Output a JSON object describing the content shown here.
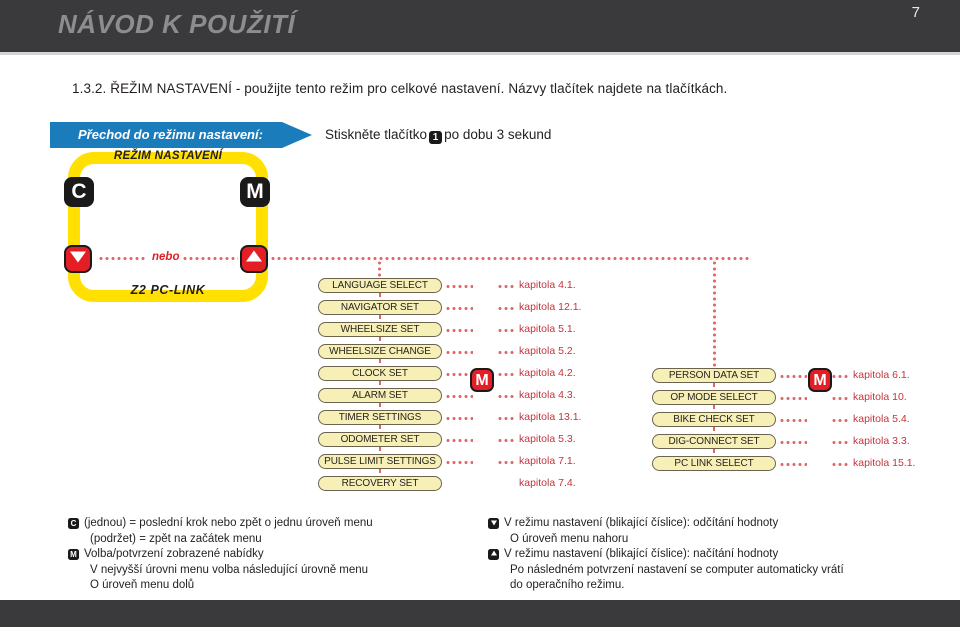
{
  "header": {
    "title": "NÁVOD K POUŽITÍ"
  },
  "intro": {
    "text": "1.3.2. ŘEŽIM NASTAVENÍ - použijte tento režim pro celkové nastavení. Názvy tlačítek najdete na tlačítkách."
  },
  "banner": {
    "label": "Přechod do režimu nastavení:",
    "instruction_before": "Stiskněte tlačítko",
    "instruction_key": "1",
    "instruction_after": "po dobu 3 sekund"
  },
  "loop": {
    "title": "REŽIM NASTAVENÍ",
    "footer": "Z2 PC-LINK",
    "key_c": "C",
    "key_m": "M",
    "or_label": "nebo"
  },
  "menu_left": {
    "badge": "M",
    "items": [
      {
        "label": "LANGUAGE SELECT",
        "chapter": "kapitola 4.1.",
        "has_dots": true
      },
      {
        "label": "NAVIGATOR SET",
        "chapter": "kapitola 12.1.",
        "has_dots": true
      },
      {
        "label": "WHEELSIZE SET",
        "chapter": "kapitola 5.1.",
        "has_dots": true
      },
      {
        "label": "WHEELSIZE CHANGE",
        "chapter": "kapitola 5.2.",
        "has_dots": true
      },
      {
        "label": "CLOCK SET",
        "chapter": "kapitola 4.2.",
        "has_dots": true
      },
      {
        "label": "ALARM SET",
        "chapter": "kapitola 4.3.",
        "has_dots": true
      },
      {
        "label": "TIMER SETTINGS",
        "chapter": "kapitola 13.1.",
        "has_dots": true
      },
      {
        "label": "ODOMETER SET",
        "chapter": "kapitola 5.3.",
        "has_dots": true
      },
      {
        "label": "PULSE LIMIT SETTINGS",
        "chapter": "kapitola 7.1.",
        "has_dots": true
      },
      {
        "label": "RECOVERY SET",
        "chapter": "kapitola 7.4.",
        "has_dots": false
      }
    ]
  },
  "menu_right": {
    "badge": "M",
    "items": [
      {
        "label": "PERSON DATA SET",
        "chapter": "kapitola 6.1.",
        "has_dots": true
      },
      {
        "label": "OP MODE SELECT",
        "chapter": "kapitola 10.",
        "has_dots": true
      },
      {
        "label": "BIKE CHECK SET",
        "chapter": "kapitola 5.4.",
        "has_dots": true
      },
      {
        "label": "DIG-CONNECT SET",
        "chapter": "kapitola 3.3.",
        "has_dots": true
      },
      {
        "label": "PC LINK SELECT",
        "chapter": "kapitola 15.1.",
        "has_dots": true
      }
    ]
  },
  "legend_left": [
    {
      "icon": "c-key-icon",
      "glyph": "C",
      "text": "(jednou) = poslední krok nebo zpět o jednu úroveň menu"
    },
    {
      "icon": "none",
      "glyph": "",
      "text": "(podržet) = zpět na začátek menu"
    },
    {
      "icon": "m-key-icon",
      "glyph": "M",
      "text": "Volba/potvrzení zobrazené nabídky"
    },
    {
      "icon": "none",
      "glyph": "",
      "text": "V nejvyšší úrovni menu volba následující úrovně menu"
    },
    {
      "icon": "none",
      "glyph": "",
      "text": "O úroveň menu dolů"
    }
  ],
  "legend_right": [
    {
      "icon": "arrow-down-key-icon",
      "glyph": "",
      "text": "V režimu nastavení (blikající číslice): odčítání hodnoty"
    },
    {
      "icon": "none",
      "glyph": "",
      "text": "O úroveň menu nahoru"
    },
    {
      "icon": "arrow-up-key-icon",
      "glyph": "",
      "text": "V režimu nastavení (blikající číslice): načítání hodnoty"
    },
    {
      "icon": "none",
      "glyph": "",
      "text": "Po následném potvrzení nastavení se computer automaticky vrátí"
    },
    {
      "icon": "none",
      "glyph": "",
      "text": "do operačního režimu."
    }
  ],
  "footer": {
    "page_number": "7"
  },
  "colors": {
    "header_bg": "#3a3a3c",
    "header_text": "#8d8d90",
    "banner_blue": "#1b7cbc",
    "loop_yellow": "#ffe000",
    "pill_fill": "#f7f0b6",
    "accent_red": "#e31e24",
    "chapter_red": "#c4343c",
    "key_black": "#1a1a1a"
  }
}
